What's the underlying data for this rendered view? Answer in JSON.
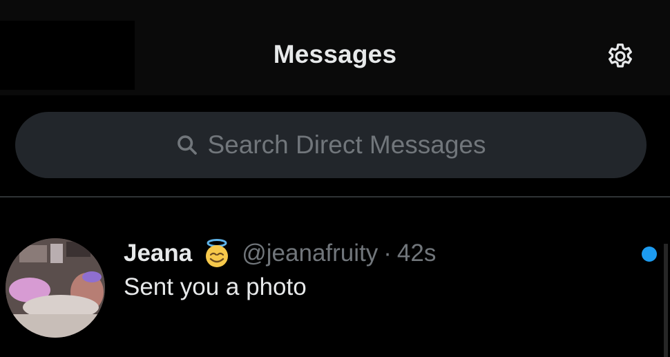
{
  "header": {
    "title": "Messages",
    "settings_icon": "gear-icon"
  },
  "search": {
    "icon": "search-icon",
    "placeholder": "Search Direct Messages"
  },
  "conversations": [
    {
      "name": "Jeana",
      "emoji": "smiling-face-with-halo",
      "handle": "@jeanafruity",
      "separator": "·",
      "time": "42s",
      "preview": "Sent you a photo",
      "unread": true
    }
  ],
  "colors": {
    "background": "#000000",
    "search_bg": "#22262b",
    "muted_text": "#71767b",
    "accent": "#1d9bf0"
  }
}
